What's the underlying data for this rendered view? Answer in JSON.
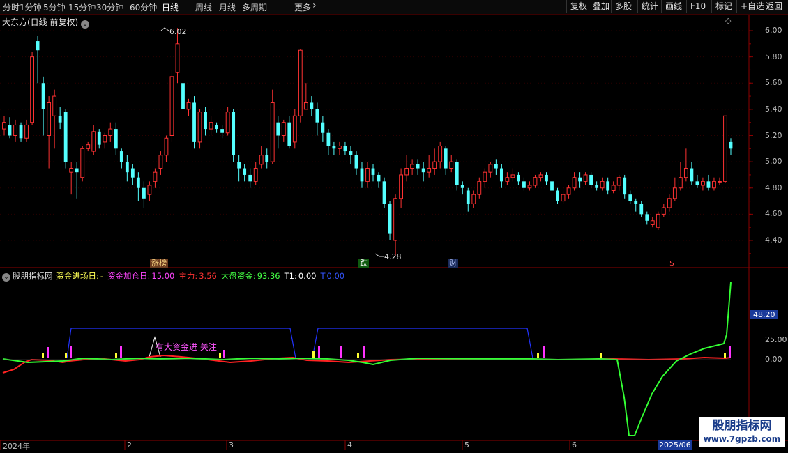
{
  "toolbar": {
    "periods": [
      "分时",
      "1分钟",
      "5分钟",
      "15分钟",
      "30分钟",
      "60分钟",
      "日线",
      "周线",
      "月线",
      "多周期",
      "更多"
    ],
    "active_period": "日线",
    "buttons": [
      "复权",
      "叠加",
      "多股",
      "统计",
      "画线",
      "F10",
      "标记",
      "+自选",
      "返回"
    ]
  },
  "main_chart": {
    "title": "大东方(日线 前复权)",
    "y_ticks": [
      "6.00",
      "5.80",
      "5.60",
      "5.40",
      "5.20",
      "5.00",
      "4.80",
      "4.60",
      "4.40"
    ],
    "high_label": "6.02",
    "low_label": "4.28",
    "markers": [
      "涨榜",
      "跌",
      "财",
      "$"
    ]
  },
  "indicator": {
    "name": "股朋指标网",
    "fields": [
      {
        "label": "资金进场日:",
        "value": "-",
        "color": "#ffff55"
      },
      {
        "label": "资金加仓日:",
        "value": "15.00",
        "color": "#ff44ff"
      },
      {
        "label": "主力:",
        "value": "3.56",
        "color": "#ff3333"
      },
      {
        "label": "大盘资金:",
        "value": "93.36",
        "color": "#44ff44"
      },
      {
        "label": "T1:",
        "value": "0.00",
        "color": "#ffffff"
      },
      {
        "label": "T",
        "value": "0.00",
        "color": "#3355ff"
      }
    ],
    "y_ticks": [
      "48.20",
      "25.00",
      "0.00"
    ],
    "annotation": "有大资金进 关注"
  },
  "x_axis": [
    "2024年",
    "2",
    "3",
    "4",
    "5",
    "6",
    "2025/06"
  ],
  "watermark": {
    "line1": "股朋指标网",
    "line2": "www.7gpzb.com"
  },
  "colors": {
    "up": "#ff3232",
    "down": "#54ffff",
    "grid": "#8b0000"
  }
}
